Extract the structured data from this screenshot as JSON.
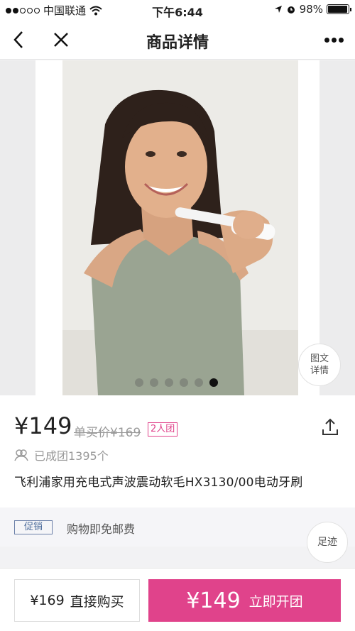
{
  "status_bar": {
    "carrier": "中国联通",
    "time": "下午6:44",
    "battery": "98%",
    "battery_level": 0.98
  },
  "nav": {
    "title": "商品详情"
  },
  "gallery": {
    "image_count": 6,
    "active_index": 5,
    "detail_badge": [
      "图文",
      "详情"
    ]
  },
  "product": {
    "price": "¥149",
    "single_price": "单买价¥169",
    "group_tag": "2人团",
    "formed_count": "已成团1395个",
    "title": "飞利浦家用充电式声波震动软毛HX3130/00电动牙刷"
  },
  "promo": {
    "tag": "促销",
    "text": "购物即免邮费"
  },
  "footprint": "足迹",
  "bottom": {
    "direct_price": "¥169",
    "direct_label": "直接购买",
    "group_price": "¥149",
    "group_label": "立即开团"
  },
  "colors": {
    "accent": "#e0438b",
    "promo_tag": "#4a6a9a"
  }
}
